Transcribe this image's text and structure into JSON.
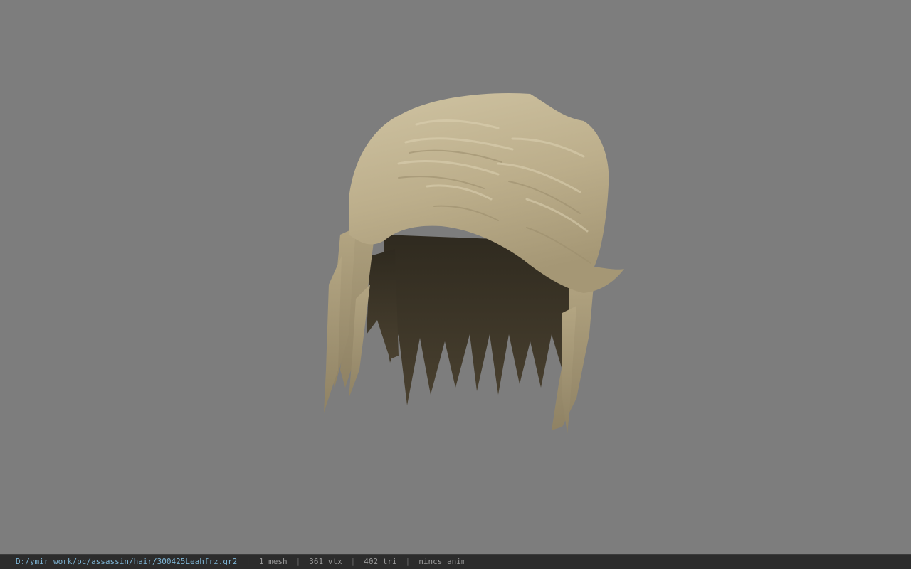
{
  "viewport": {
    "background_color": "#7d7d7d",
    "model": {
      "subject": "hair mesh",
      "colors": {
        "hair_light": "#c9bc9a",
        "hair_mid": "#b3a582",
        "hair_shadow": "#8f8264",
        "hair_dark_inner": "#3f382a"
      }
    }
  },
  "statusbar": {
    "path": "D:/ymir work/pc/assassin/hair/300425Leahfrz.gr2",
    "mesh": "1 mesh",
    "vtx": "361 vtx",
    "tri": "402 tri",
    "anim": "nincs anim",
    "separator": "|"
  }
}
